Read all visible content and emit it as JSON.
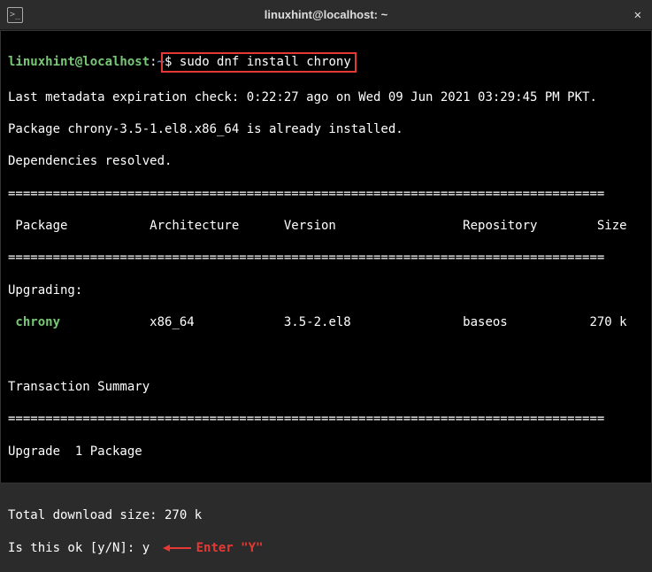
{
  "titlebar": {
    "title": "linuxhint@localhost: ~",
    "icon_label": ">_"
  },
  "prompt": {
    "user_host": "linuxhint@localhost",
    "sep": ":",
    "cwd": "~",
    "dollar": "$"
  },
  "command": "sudo dnf install chrony",
  "output": {
    "metadata": "Last metadata expiration check: 0:22:27 ago on Wed 09 Jun 2021 03:29:45 PM PKT.",
    "already": "Package chrony-3.5-1.el8.x86_64 is already installed.",
    "deps": "Dependencies resolved.",
    "divider": "================================================================================",
    "header": " Package           Architecture      Version                 Repository        Size",
    "upgrading": "Upgrading:",
    "pkg_name": " chrony",
    "pkg_rest": "            x86_64            3.5-2.el8               baseos           270 k",
    "txn_summary": "Transaction Summary",
    "upgrade_count": "Upgrade  1 Package",
    "dl_size": "Total download size: 270 k",
    "isok": "Is this ok [y/N]: ",
    "answer": "y"
  },
  "annotation": {
    "text": "Enter \"Y\""
  }
}
